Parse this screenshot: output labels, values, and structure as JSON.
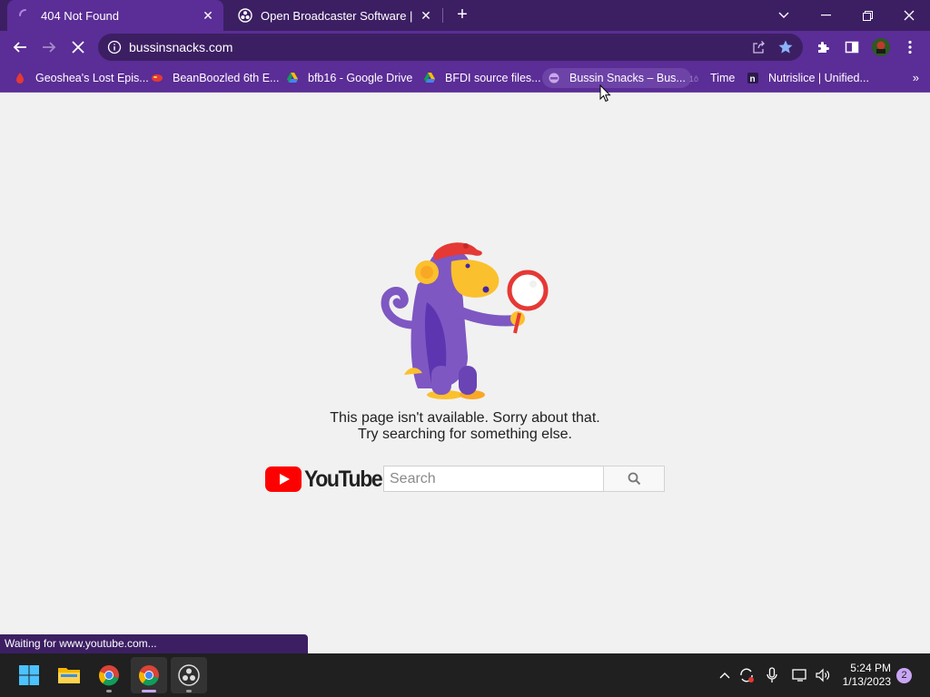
{
  "tabs": [
    {
      "title": "404 Not Found",
      "close": "✕"
    },
    {
      "title": "Open Broadcaster Software | OBS",
      "close": "✕"
    }
  ],
  "toolbar": {
    "url": "bussinsnacks.com"
  },
  "bookmarks": [
    {
      "label": "Geoshea's Lost Epis...",
      "icon": "red-droplet-icon"
    },
    {
      "label": "BeanBoozled 6th E...",
      "icon": "jellybean-icon"
    },
    {
      "label": "bfb16 - Google Drive",
      "icon": "google-drive-icon"
    },
    {
      "label": "BFDI source files...",
      "icon": "google-drive-icon"
    },
    {
      "label": "Bussin Snacks – Bus...",
      "icon": "snack-icon"
    },
    {
      "label": "Time",
      "icon": "time-icon"
    },
    {
      "label": "Nutrislice | Unified...",
      "icon": "nutrislice-icon"
    }
  ],
  "page": {
    "message_line1": "This page isn't available. Sorry about that.",
    "message_line2": "Try searching for something else.",
    "logo_text": "YouTube",
    "search_placeholder": "Search"
  },
  "status_text": "Waiting for www.youtube.com...",
  "taskbar": {
    "time": "5:24 PM",
    "date": "1/13/2023",
    "notification_count": "2"
  },
  "colors": {
    "frame": "#3c1f63",
    "toolbar": "#5b2d96",
    "page_bg": "#f1f1f1",
    "youtube_red": "#ff0000"
  }
}
